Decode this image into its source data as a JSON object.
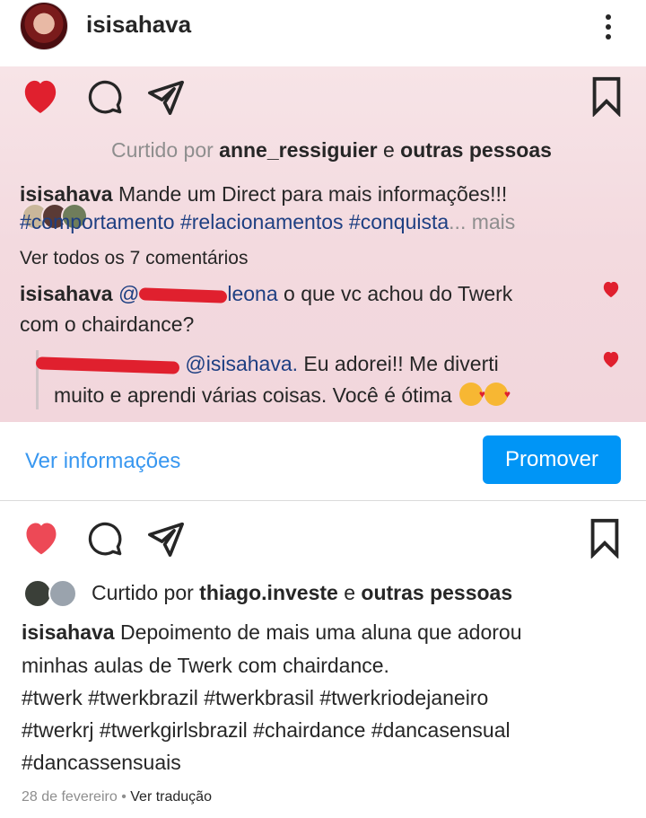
{
  "header": {
    "username": "isisahava"
  },
  "embedded_post": {
    "liked_by_prefix": "Curtido por",
    "liked_by_user": "anne_ressiguier",
    "liked_by_conj": "e",
    "liked_by_others": "outras pessoas",
    "caption_user": "isisahava",
    "caption_text": "Mande um Direct para mais informações!!!",
    "caption_tags": "#comportamento #relacionamentos #conquista",
    "more": "... mais",
    "view_comments": "Ver todos os 7 comentários",
    "comment1": {
      "user": "isisahava",
      "mention_partial": "@",
      "mention_tail": "leona",
      "text_1": "o que vc achou do Twerk",
      "text_2": "com o chairdance?"
    },
    "comment2": {
      "mention": "@isisahava.",
      "text_1": "Eu adorei!! Me diverti",
      "text_2": "muito e aprendi várias coisas. Você é ótima"
    }
  },
  "actions": {
    "view_insights": "Ver informações",
    "promote": "Promover"
  },
  "post": {
    "liked_by_prefix": "Curtido por",
    "liked_by_user": "thiago.investe",
    "liked_by_conj": "e",
    "liked_by_others": "outras pessoas",
    "caption_user": "isisahava",
    "caption_line1": "Depoimento de mais uma aluna que adorou",
    "caption_line2": "minhas aulas de Twerk com chairdance.",
    "tags_line1": "#twerk #twerkbrazil #twerkbrasil #twerkriodejaneiro",
    "tags_line2": "#twerkrj #twerkgirlsbrazil #chairdance #dancasensual",
    "tags_line3": "#dancassensuais",
    "date": "28 de fevereiro",
    "separator": "•",
    "see_translation": "Ver tradução"
  },
  "colors": {
    "like_red": "#ed4956",
    "link_blue": "#3897f0",
    "hashtag": "#1e3f82",
    "promote_bg": "#0095f6"
  },
  "icons": [
    "heart-icon",
    "comment-icon",
    "share-icon",
    "bookmark-icon",
    "more-icon"
  ]
}
